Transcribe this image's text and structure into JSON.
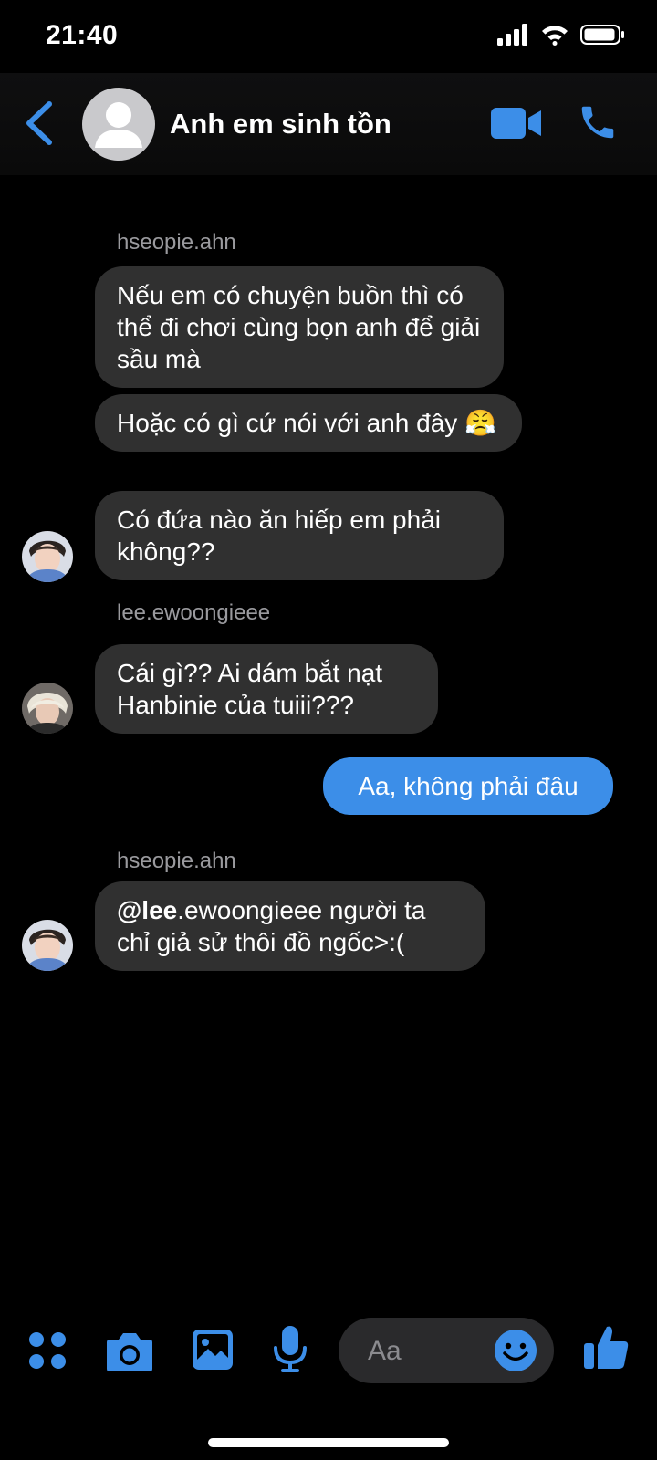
{
  "status_bar": {
    "time": "21:40"
  },
  "header": {
    "title": "Anh em sinh tồn"
  },
  "messages": [
    {
      "sender": "hseopie.ahn"
    },
    {
      "text": "Nếu em có chuyện buồn thì có thể đi chơi cùng bọn anh để giải sầu mà"
    },
    {
      "text": "Hoặc có gì cứ nói với anh đây",
      "emoji": "😤"
    },
    {
      "text": "Có đứa nào ăn hiếp em phải không??"
    },
    {
      "sender": "lee.ewoongieee"
    },
    {
      "text": "Cái gì?? Ai dám bắt nạt Hanbinie của tuiii???"
    },
    {
      "text": "Aa, không phải đâu"
    },
    {
      "sender": "hseopie.ahn"
    },
    {
      "mention": "@lee",
      "text": ".ewoongieee người ta chỉ giả sử thôi đồ ngốc>:("
    }
  ],
  "composer": {
    "placeholder": "Aa"
  },
  "colors": {
    "accent": "#3c8ee8",
    "bubble_other": "#303030",
    "background": "#000000"
  }
}
